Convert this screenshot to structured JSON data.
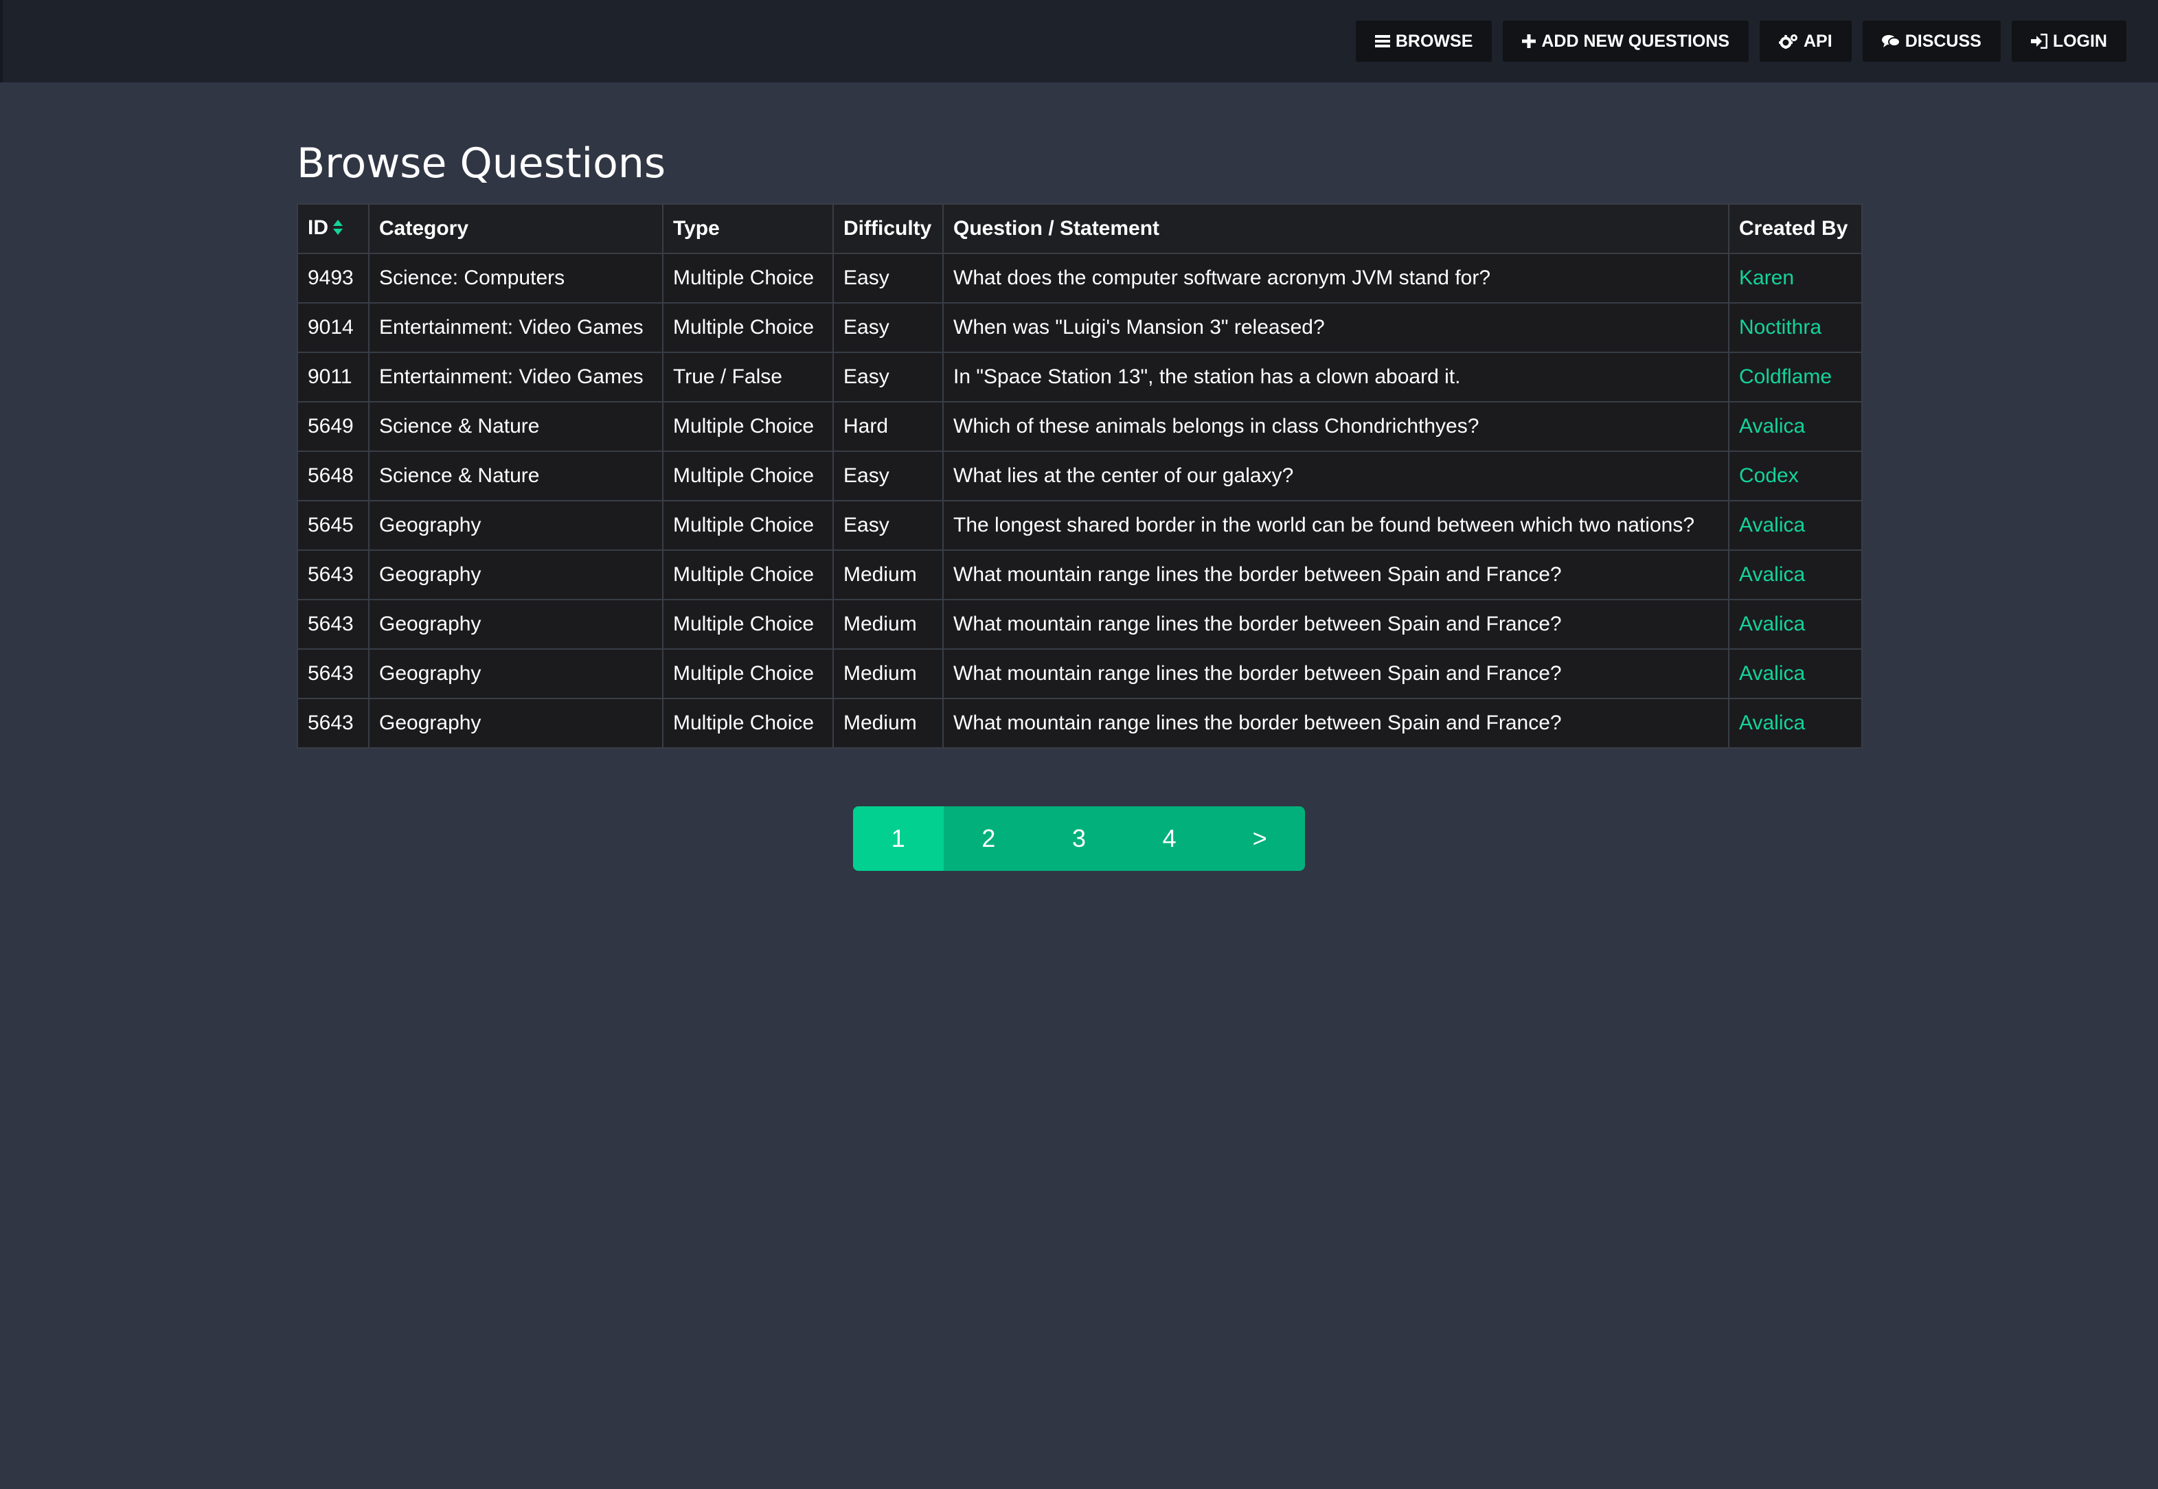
{
  "nav": {
    "items": [
      {
        "label": "BROWSE",
        "icon": "bars-icon"
      },
      {
        "label": "ADD NEW QUESTIONS",
        "icon": "plus-icon"
      },
      {
        "label": "API",
        "icon": "gears-icon"
      },
      {
        "label": "DISCUSS",
        "icon": "comments-icon"
      },
      {
        "label": "LOGIN",
        "icon": "sign-in-icon"
      }
    ]
  },
  "page": {
    "title": "Browse Questions"
  },
  "table": {
    "columns": [
      "ID",
      "Category",
      "Type",
      "Difficulty",
      "Question / Statement",
      "Created By"
    ],
    "sorted_column": "ID",
    "rows": [
      {
        "id": "9493",
        "category": "Science: Computers",
        "type": "Multiple Choice",
        "difficulty": "Easy",
        "question": "What does the computer software acronym JVM stand for?",
        "created_by": "Karen"
      },
      {
        "id": "9014",
        "category": "Entertainment: Video Games",
        "type": "Multiple Choice",
        "difficulty": "Easy",
        "question": "When was \"Luigi's Mansion 3\" released?",
        "created_by": "Noctithra"
      },
      {
        "id": "9011",
        "category": "Entertainment: Video Games",
        "type": "True / False",
        "difficulty": "Easy",
        "question": "In \"Space Station 13\", the station has a clown aboard it.",
        "created_by": "Coldflame"
      },
      {
        "id": "5649",
        "category": "Science & Nature",
        "type": "Multiple Choice",
        "difficulty": "Hard",
        "question": "Which of these animals belongs in class Chondrichthyes?",
        "created_by": "Avalica"
      },
      {
        "id": "5648",
        "category": "Science & Nature",
        "type": "Multiple Choice",
        "difficulty": "Easy",
        "question": "What lies at the center of our galaxy?",
        "created_by": "Codex"
      },
      {
        "id": "5645",
        "category": "Geography",
        "type": "Multiple Choice",
        "difficulty": "Easy",
        "question": "The longest shared border in the world can be found between which two nations?",
        "created_by": "Avalica"
      },
      {
        "id": "5643",
        "category": "Geography",
        "type": "Multiple Choice",
        "difficulty": "Medium",
        "question": "What mountain range lines the border between Spain and France?",
        "created_by": "Avalica"
      },
      {
        "id": "5643",
        "category": "Geography",
        "type": "Multiple Choice",
        "difficulty": "Medium",
        "question": "What mountain range lines the border between Spain and France?",
        "created_by": "Avalica"
      },
      {
        "id": "5643",
        "category": "Geography",
        "type": "Multiple Choice",
        "difficulty": "Medium",
        "question": "What mountain range lines the border between Spain and France?",
        "created_by": "Avalica"
      },
      {
        "id": "5643",
        "category": "Geography",
        "type": "Multiple Choice",
        "difficulty": "Medium",
        "question": "What mountain range lines the border between Spain and France?",
        "created_by": "Avalica"
      }
    ]
  },
  "pagination": {
    "pages": [
      "1",
      "2",
      "3",
      "4",
      ">"
    ],
    "current": "1"
  },
  "colors": {
    "accent": "#02b07b",
    "accent_active": "#02d090",
    "link": "#14d49a",
    "background": "#303644",
    "navbar": "#1e222b"
  }
}
